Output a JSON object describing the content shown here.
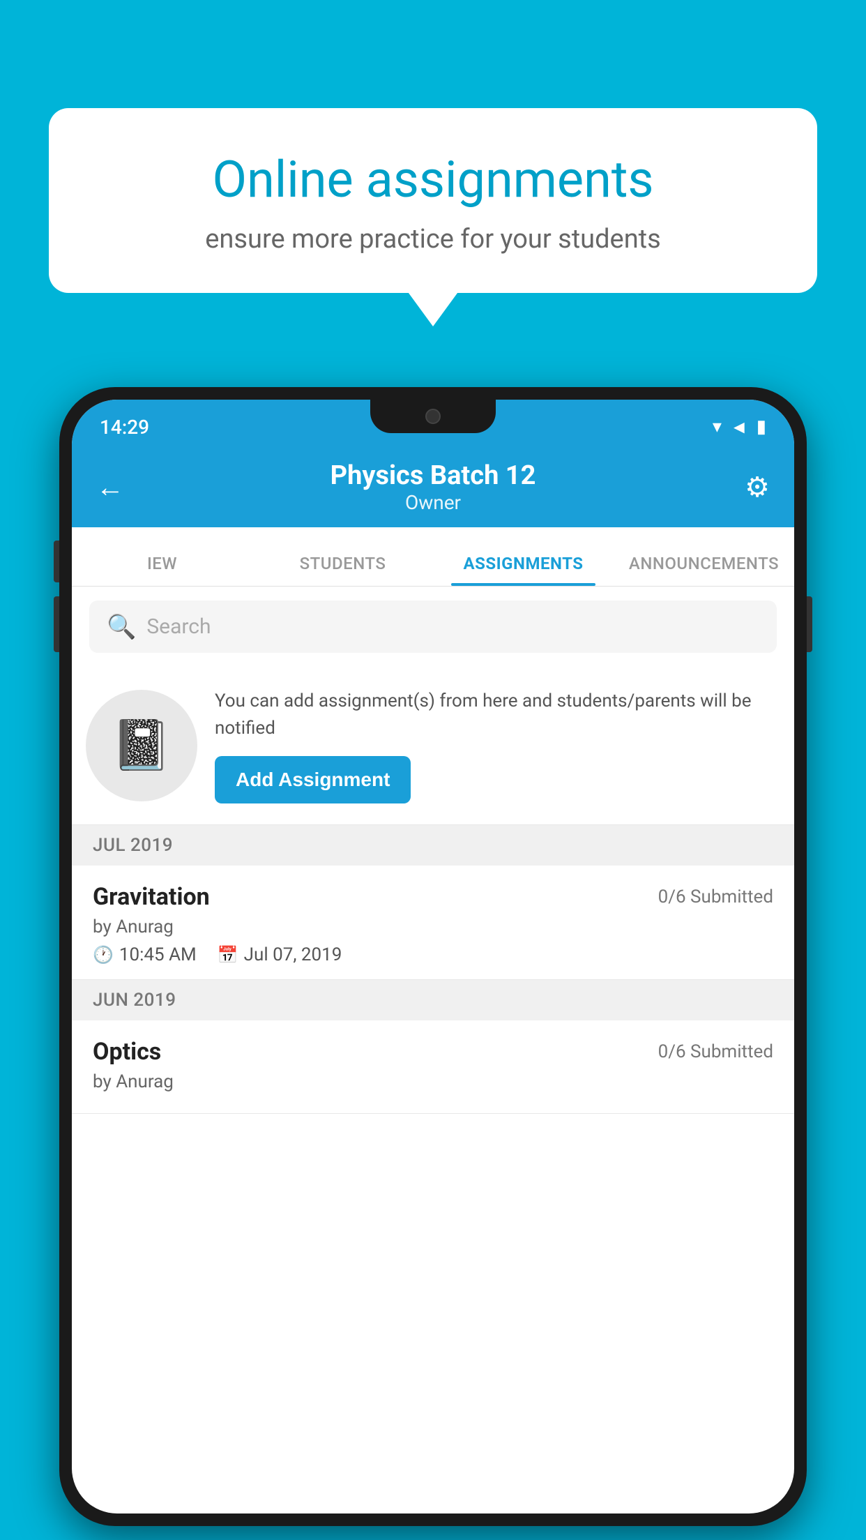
{
  "background_color": "#00b4d8",
  "speech_bubble": {
    "title": "Online assignments",
    "subtitle": "ensure more practice for your students"
  },
  "status_bar": {
    "time": "14:29",
    "icons": [
      "wifi",
      "signal",
      "battery"
    ]
  },
  "header": {
    "title": "Physics Batch 12",
    "subtitle": "Owner",
    "back_label": "←",
    "settings_label": "⚙"
  },
  "tabs": [
    {
      "label": "IEW",
      "active": false
    },
    {
      "label": "STUDENTS",
      "active": false
    },
    {
      "label": "ASSIGNMENTS",
      "active": true
    },
    {
      "label": "ANNOUNCEMENTS",
      "active": false
    }
  ],
  "search": {
    "placeholder": "Search"
  },
  "promo": {
    "text": "You can add assignment(s) from here and students/parents will be notified",
    "button_label": "Add Assignment"
  },
  "sections": [
    {
      "header": "JUL 2019",
      "assignments": [
        {
          "name": "Gravitation",
          "status": "0/6 Submitted",
          "author": "by Anurag",
          "time": "10:45 AM",
          "date": "Jul 07, 2019"
        }
      ]
    },
    {
      "header": "JUN 2019",
      "assignments": [
        {
          "name": "Optics",
          "status": "0/6 Submitted",
          "author": "by Anurag",
          "time": "",
          "date": ""
        }
      ]
    }
  ]
}
